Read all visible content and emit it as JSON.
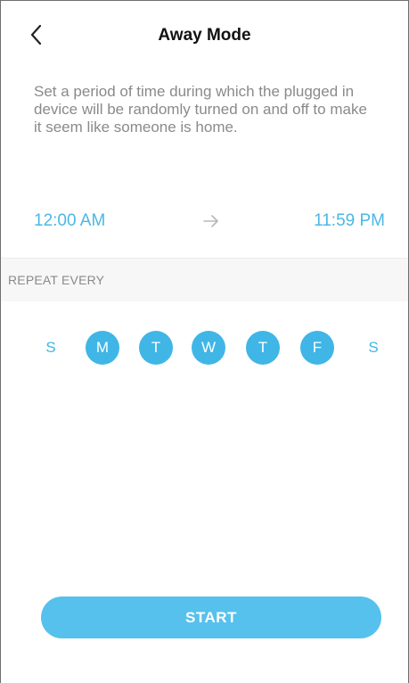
{
  "header": {
    "title": "Away Mode",
    "back_icon": "chevron-left-icon"
  },
  "description": "Set a period of time during which the plugged in device will be randomly turned on and off to make it seem like someone is home.",
  "schedule": {
    "start_time": "12:00 AM",
    "end_time": "11:59 PM",
    "arrow_icon": "arrow-right-icon"
  },
  "repeat": {
    "label": "REPEAT EVERY",
    "days": [
      {
        "letter": "S",
        "selected": false
      },
      {
        "letter": "M",
        "selected": true
      },
      {
        "letter": "T",
        "selected": true
      },
      {
        "letter": "W",
        "selected": true
      },
      {
        "letter": "T",
        "selected": true
      },
      {
        "letter": "F",
        "selected": true
      },
      {
        "letter": "S",
        "selected": false
      }
    ]
  },
  "actions": {
    "start_label": "START"
  },
  "colors": {
    "accent": "#3fb6e6",
    "text_muted": "#8a8a8a",
    "title": "#111111"
  }
}
